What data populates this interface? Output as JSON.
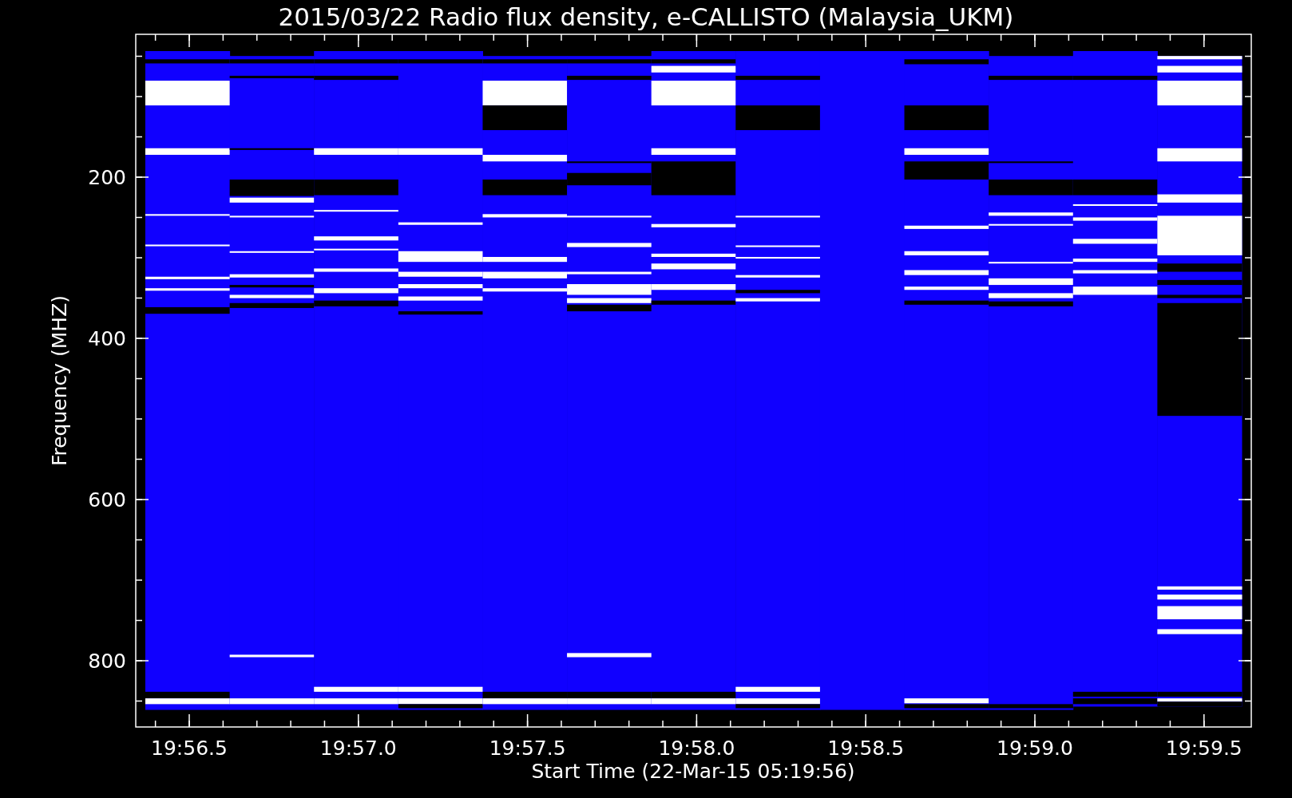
{
  "chart": {
    "title": "2015/03/22  Radio flux density, e-CALLISTO (Malaysia_UKM)",
    "ylabel": "Frequency (MHZ)",
    "yticks": [
      "200",
      "400",
      "600",
      "800"
    ],
    "xticks": [
      "19:56.5",
      "19:57.0",
      "19:57.5",
      "19:58.0",
      "19:58.5",
      "19:59.0",
      "19:59.5"
    ],
    "xlabel": "Start Time (22-Mar-15 05:19:56)"
  }
}
